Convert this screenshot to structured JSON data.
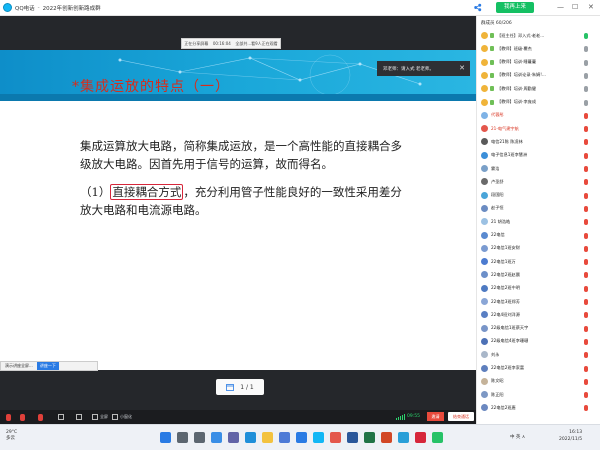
{
  "window": {
    "app_name": "QQ电话",
    "group_title": "2022年创新创新路成群",
    "mic_button_label": "我再上来",
    "minimize": "—",
    "maximize": "☐",
    "close": "✕"
  },
  "share_tip": {
    "label": "正在分享屏幕",
    "time": "00:16:04",
    "status": "全部共...看9人正在观看"
  },
  "slide": {
    "title": "*集成运放的特点（一）",
    "paragraph1": "集成运算放大电路，简称集成运放，是一个高性能的直接耦合多级放大电路。因首先用于信号的运算，故而得名。",
    "p2_prefix": "（1）",
    "p2_boxed": "直接耦合方式",
    "p2_rest": "，充分利用管子性能良好的一致性采用差分放大电路和电流源电路。"
  },
  "notification": {
    "text": "邓老师：请入式 老老师。",
    "close": "✕"
  },
  "tab_chip": {
    "label": "演示讲座全屏...",
    "current": "讲座一下"
  },
  "pager": {
    "page": "1 / 1"
  },
  "toolbar": {
    "camera_label": "打开",
    "share_label": "分享",
    "fullscreen_label": "全屏",
    "smallwin_label": "小窗化",
    "elapsed": "09:55",
    "red_button": "邀请",
    "end_button": "结束通话"
  },
  "panel": {
    "header": "群成员 60/206",
    "members": [
      {
        "name": "【班主任】邓入式·老老..."
      },
      {
        "name": "【教师】班级·覆杰"
      },
      {
        "name": "【教师】培训·睡蔓蔓"
      },
      {
        "name": "【教师】培训论录·朱娟!..."
      },
      {
        "name": "【教师】培训·周勤健"
      },
      {
        "name": "【教师】培训·李庞成"
      },
      {
        "name": "代蓉彤"
      },
      {
        "name": "21-电气建宇航"
      },
      {
        "name": "电信21陈 陈凌林"
      },
      {
        "name": "电子信息1班李慧洲"
      },
      {
        "name": "雾浩"
      },
      {
        "name": "卢圣舒"
      },
      {
        "name": "段国阳"
      },
      {
        "name": "赵子恒"
      },
      {
        "name": "21 胡浩皓"
      },
      {
        "name": "22电信"
      },
      {
        "name": "22电信1班安财"
      },
      {
        "name": "22电信1班万"
      },
      {
        "name": "22电信2班赵晨"
      },
      {
        "name": "22电信2班中明"
      },
      {
        "name": "22电信3班郑芳"
      },
      {
        "name": "22电4班刘洋源"
      },
      {
        "name": "22级电信1班蔡天宇"
      },
      {
        "name": "22级电信4班李珊珊"
      },
      {
        "name": "刘永"
      },
      {
        "name": "22电信2班李家富"
      },
      {
        "name": "陈文昭"
      },
      {
        "name": "陈正阳"
      },
      {
        "name": "22电信2班唐"
      }
    ]
  },
  "taskbar": {
    "temp": "29°C",
    "weather": "多云",
    "tray_text": "中 英 ∧",
    "time": "16:13",
    "date": "2022/11/5"
  },
  "colors": {
    "accent": "#12b7f5",
    "slide_header": "#1aa7d9",
    "title_red": "#d62d1c",
    "end_red": "#e84a3c",
    "ok_green": "#27c267"
  }
}
